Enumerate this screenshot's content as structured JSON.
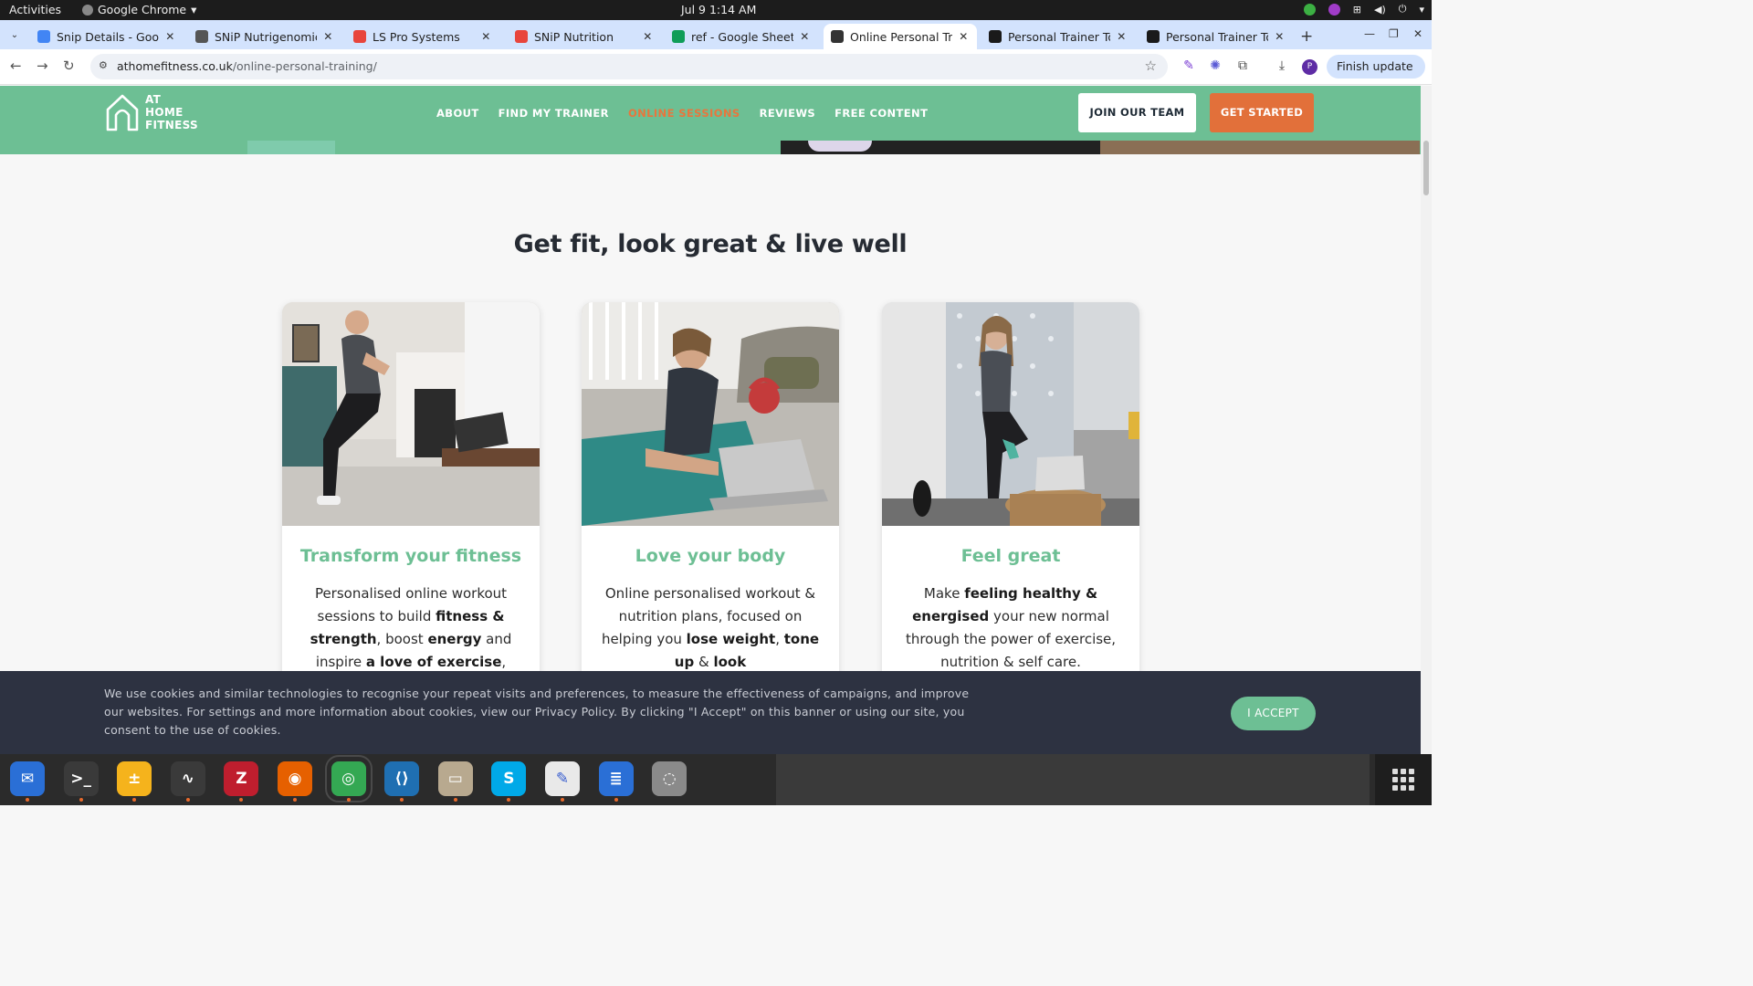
{
  "system": {
    "activities": "Activities",
    "app_name": "Google Chrome",
    "clock": "Jul 9  1:14 AM"
  },
  "browser": {
    "tabs": [
      {
        "title": "Snip Details - Google",
        "favicon_color": "#4285f4"
      },
      {
        "title": "SNiP Nutrigenomics",
        "favicon_color": "#555555"
      },
      {
        "title": "LS Pro Systems",
        "favicon_color": "#e8453c"
      },
      {
        "title": "SNiP Nutrition",
        "favicon_color": "#e8453c"
      },
      {
        "title": "ref - Google Sheets",
        "favicon_color": "#0f9d58"
      },
      {
        "title": "Online Personal Trai",
        "favicon_color": "#333333"
      },
      {
        "title": "Personal Trainer Tor",
        "favicon_color": "#1a1a1a"
      },
      {
        "title": "Personal Trainer Tor",
        "favicon_color": "#1a1a1a"
      }
    ],
    "active_tab_index": 5,
    "url_domain": "athomefitness.co.uk",
    "url_path": "/online-personal-training/",
    "finish_update": "Finish update",
    "profile_initial": "P"
  },
  "site": {
    "logo_lines": [
      "AT",
      "HOME",
      "FITNESS"
    ],
    "nav": [
      {
        "label": "ABOUT",
        "current": false
      },
      {
        "label": "FIND MY TRAINER",
        "current": false
      },
      {
        "label": "ONLINE SESSIONS",
        "current": true
      },
      {
        "label": "REVIEWS",
        "current": false
      },
      {
        "label": "FREE CONTENT",
        "current": false
      }
    ],
    "join_button": "JOIN OUR TEAM",
    "start_button": "GET STARTED",
    "headline": "Get fit, look great & live well",
    "colors": {
      "brand_green": "#6dbf94",
      "accent_orange": "#e2703a",
      "dark": "#262b33"
    },
    "cards": [
      {
        "title": "Transform your fitness",
        "body": [
          {
            "t": "Personalised online workout sessions to build ",
            "b": false
          },
          {
            "t": "fitness & strength",
            "b": true
          },
          {
            "t": ", boost ",
            "b": false
          },
          {
            "t": "energy",
            "b": true
          },
          {
            "t": " and inspire ",
            "b": false
          },
          {
            "t": "a love of exercise",
            "b": true
          },
          {
            "t": ",",
            "b": false
          }
        ]
      },
      {
        "title": "Love your body",
        "body": [
          {
            "t": "Online personalised workout & nutrition plans, focused on helping you ",
            "b": false
          },
          {
            "t": "lose weight",
            "b": true
          },
          {
            "t": ", ",
            "b": false
          },
          {
            "t": "tone up",
            "b": true
          },
          {
            "t": " & ",
            "b": false
          },
          {
            "t": "look",
            "b": true
          }
        ]
      },
      {
        "title": "Feel great",
        "body": [
          {
            "t": "Make ",
            "b": false
          },
          {
            "t": "feeling healthy & energised",
            "b": true
          },
          {
            "t": " your new normal through the power of exercise, nutrition & self care.",
            "b": false
          }
        ]
      }
    ],
    "cookie_text": "We use cookies and similar technologies to recognise your repeat visits and preferences, to measure the effectiveness of campaigns, and improve our websites. For settings and more information about cookies, view our Privacy Policy. By clicking \"I Accept\" on this banner or using our site, you consent to the use of cookies.",
    "cookie_accept": "I ACCEPT"
  },
  "dock": [
    {
      "name": "thunderbird",
      "color": "#2a6fd6",
      "glyph": "✉",
      "running": true
    },
    {
      "name": "terminal",
      "color": "#3a3a3a",
      "glyph": ">_",
      "running": true
    },
    {
      "name": "calculator",
      "color": "#f5b31c",
      "glyph": "±",
      "running": true
    },
    {
      "name": "system-monitor",
      "color": "#3a3a3a",
      "glyph": "∿",
      "running": true
    },
    {
      "name": "filezilla",
      "color": "#bf1e2e",
      "glyph": "Z",
      "running": true
    },
    {
      "name": "firefox",
      "color": "#e66000",
      "glyph": "◉",
      "running": true
    },
    {
      "name": "chrome",
      "color": "#34a853",
      "glyph": "◎",
      "running": true
    },
    {
      "name": "vscode",
      "color": "#1f6fb2",
      "glyph": "⟨⟩",
      "running": true
    },
    {
      "name": "files",
      "color": "#b8a98f",
      "glyph": "▭",
      "running": true
    },
    {
      "name": "skype",
      "color": "#00a9e8",
      "glyph": "S",
      "running": true
    },
    {
      "name": "text-editor",
      "color": "#e9e9e9",
      "glyph": "✎",
      "running": true
    },
    {
      "name": "libreoffice-writer",
      "color": "#2a6fd6",
      "glyph": "≣",
      "running": true
    },
    {
      "name": "disks",
      "color": "#8a8a8a",
      "glyph": "◌",
      "running": false
    }
  ]
}
